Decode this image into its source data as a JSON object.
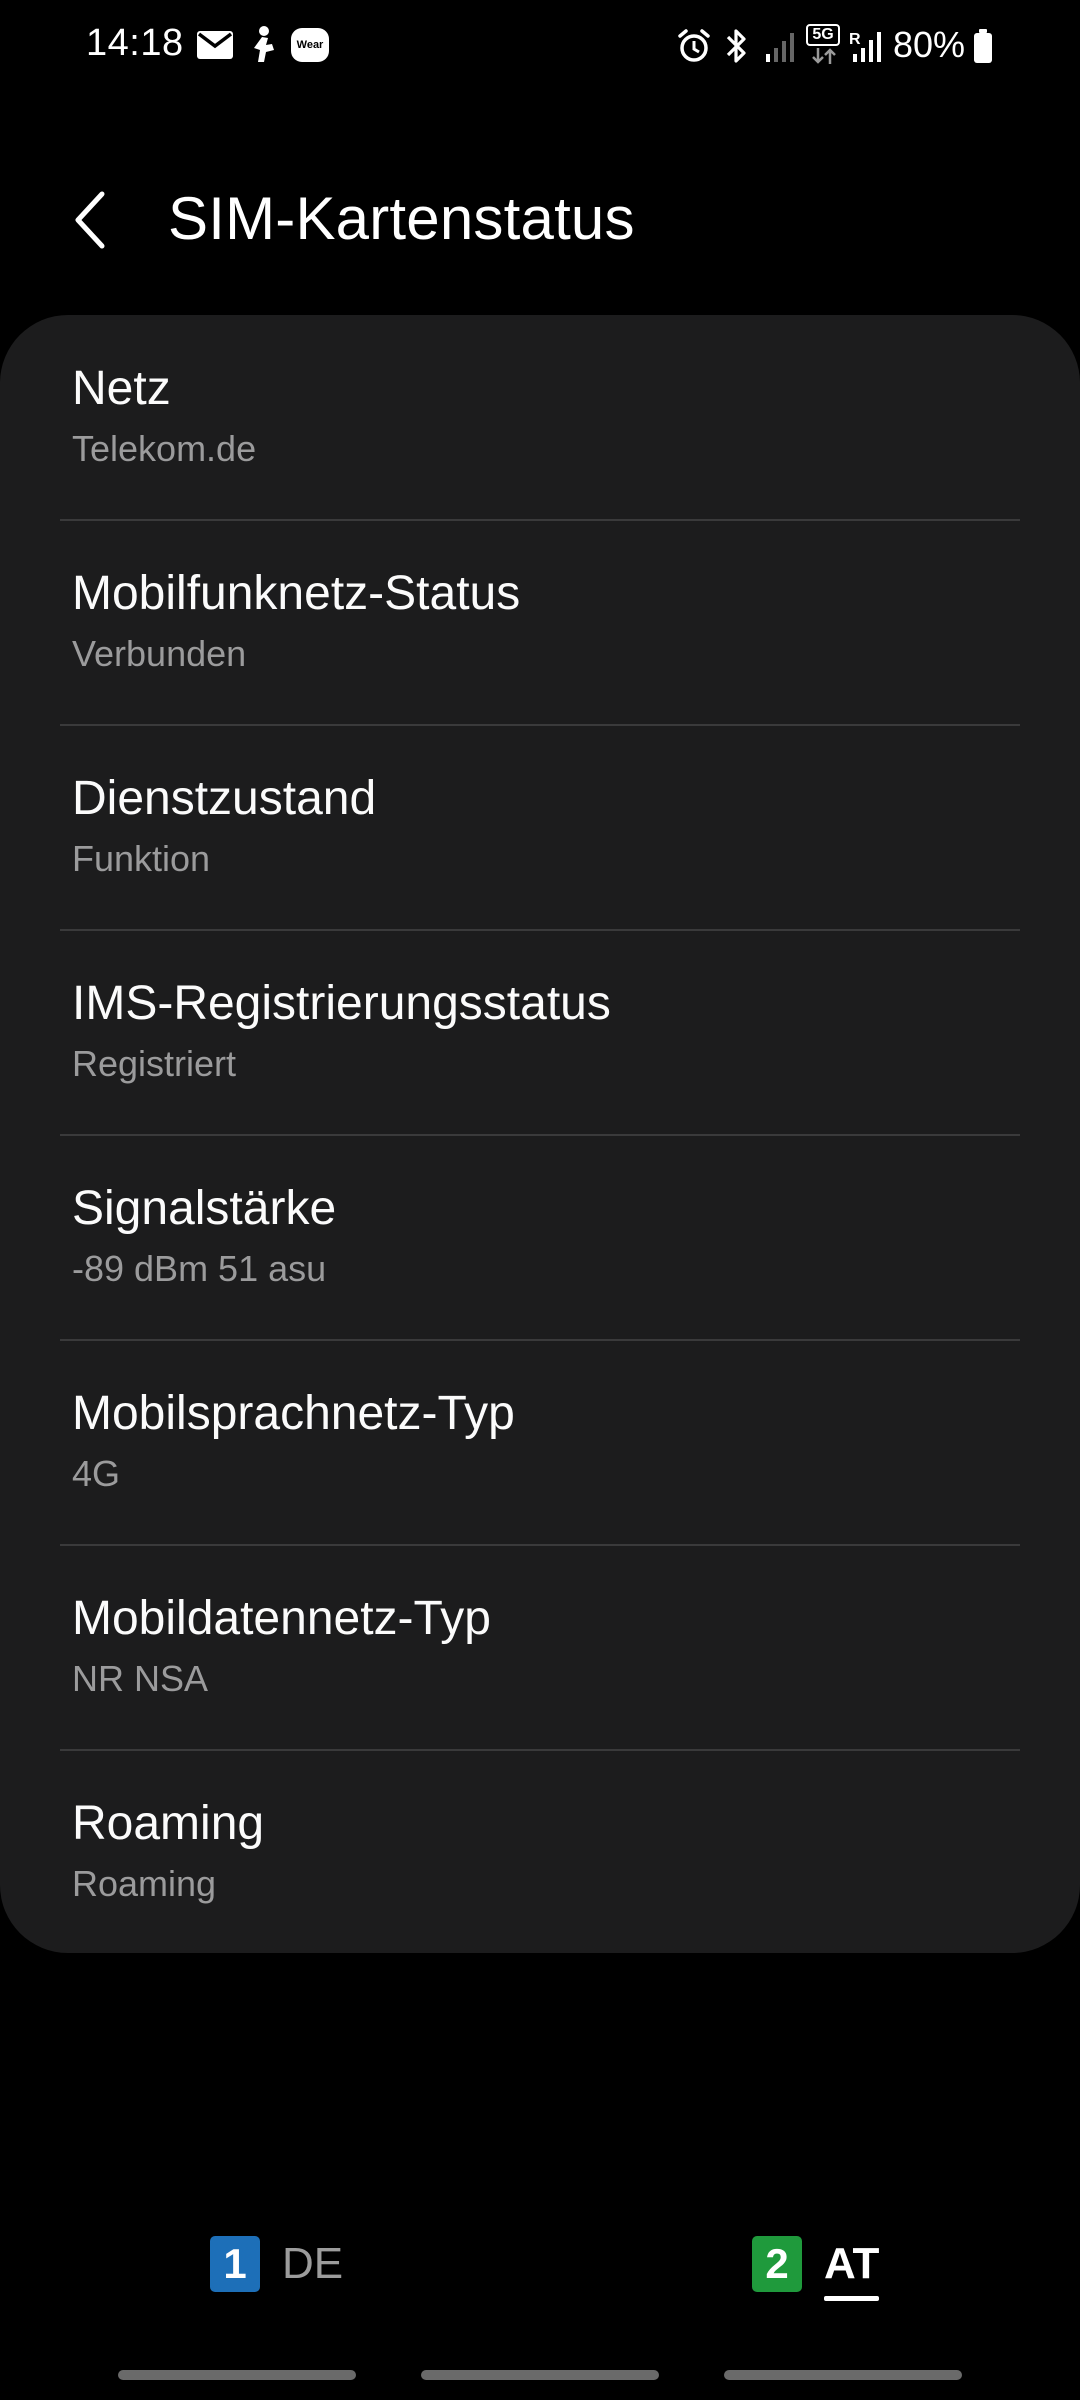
{
  "status_bar": {
    "time": "14:18",
    "battery": "80%",
    "network_badge": "5G",
    "wear_label": "Wear",
    "icons": [
      "mail-icon",
      "person-walk-icon",
      "wear-icon",
      "alarm-icon",
      "bluetooth-icon",
      "signal-weak-icon",
      "5g-data-icon",
      "signal-roaming-icon",
      "battery-icon"
    ]
  },
  "header": {
    "title": "SIM-Kartenstatus",
    "back_icon": "chevron-left-icon"
  },
  "items": [
    {
      "title": "Netz",
      "value": "Telekom.de"
    },
    {
      "title": "Mobilfunknetz-Status",
      "value": "Verbunden"
    },
    {
      "title": "Dienstzustand",
      "value": "Funktion"
    },
    {
      "title": "IMS-Registrierungsstatus",
      "value": "Registriert"
    },
    {
      "title": "Signalstärke",
      "value": "-89 dBm 51 asu"
    },
    {
      "title": "Mobilsprachnetz-Typ",
      "value": "4G"
    },
    {
      "title": "Mobildatennetz-Typ",
      "value": "NR NSA"
    },
    {
      "title": "Roaming",
      "value": "Roaming"
    }
  ],
  "sim_tabs": [
    {
      "number": "1",
      "label": "DE",
      "selected": false,
      "color": "#1d6fb8"
    },
    {
      "number": "2",
      "label": "AT",
      "selected": true,
      "color": "#1f9a3c"
    }
  ],
  "colors": {
    "background": "#000000",
    "card": "#1c1c1d",
    "secondary_text": "#9b9b9c"
  }
}
